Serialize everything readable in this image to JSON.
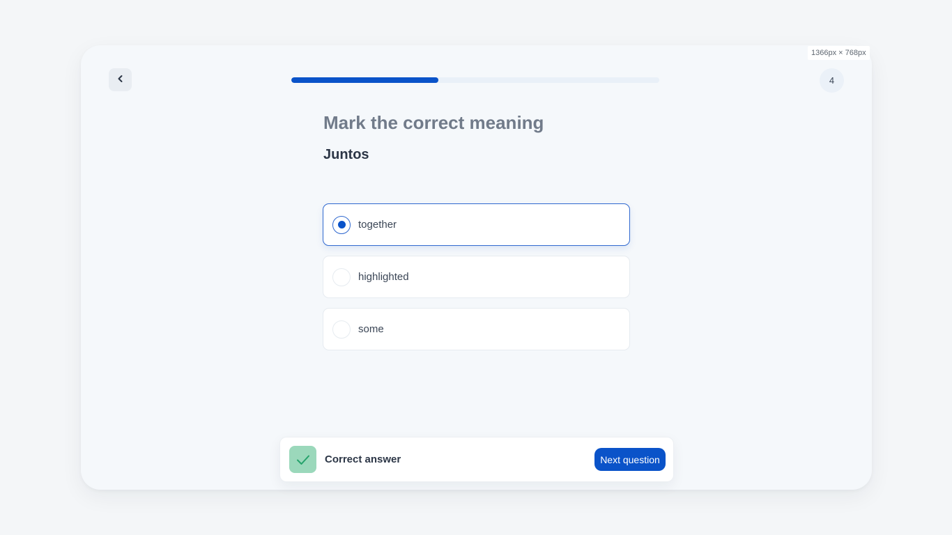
{
  "viewport_badge": "1366px × 768px",
  "header": {
    "back_icon": "chevron-left-icon",
    "progress": 0.4,
    "progress_color": "#0a53c9",
    "question_number": "4"
  },
  "question": {
    "prompt": "Mark the correct meaning",
    "word": "Juntos"
  },
  "options": [
    {
      "label": "together",
      "selected": true
    },
    {
      "label": "highlighted",
      "selected": false
    },
    {
      "label": "some",
      "selected": false
    }
  ],
  "feedback": {
    "icon": "check-icon",
    "status_text": "Correct answer",
    "status_color": "#9bd8bb",
    "next_label": "Next question",
    "accent_color": "#0a53c9"
  }
}
